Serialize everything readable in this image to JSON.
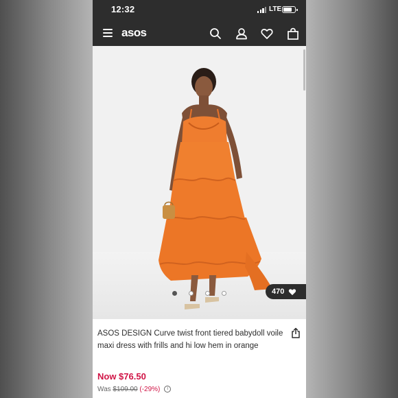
{
  "status_bar": {
    "time": "12:32",
    "network": "LTE",
    "battery_level": 0.75
  },
  "nav": {
    "logo": "asos",
    "icons": [
      "menu-icon",
      "search-icon",
      "account-icon",
      "saved-items-icon",
      "bag-icon"
    ]
  },
  "product_image": {
    "alt_content": "model wearing orange tiered maxi dress",
    "saves_count": "470",
    "carousel": {
      "total": 4,
      "active_index": 0
    }
  },
  "product": {
    "title": "ASOS DESIGN Curve twist front tiered babydoll voile maxi dress with frills and hi low hem in orange",
    "price_now": "Now $76.50",
    "price_was_prefix": "Was ",
    "price_was_value": "$109.00",
    "price_discount": "(-29%)"
  },
  "colors": {
    "header_bg": "#2d2d2d",
    "sale_red": "#d01345",
    "dress_orange": "#ee7a2a"
  }
}
